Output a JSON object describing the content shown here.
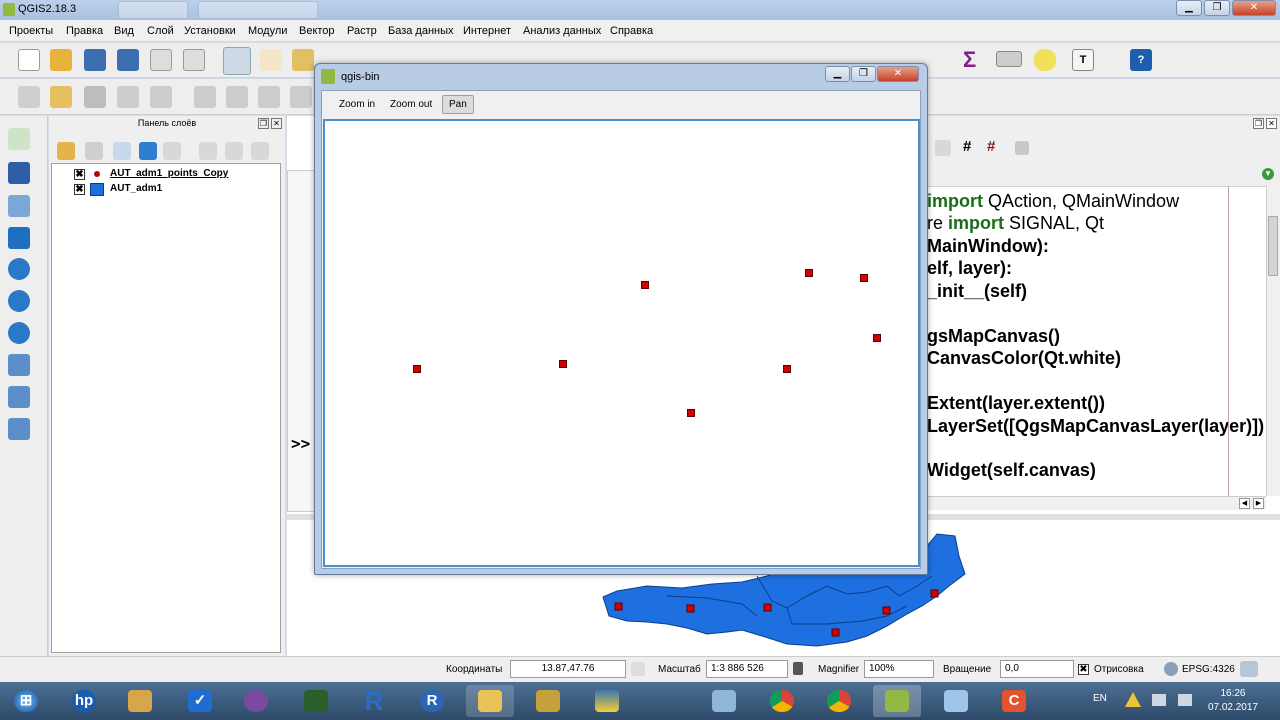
{
  "app": {
    "title": "QGIS2.18.3"
  },
  "menubar": [
    "Проекты",
    "Правка",
    "Вид",
    "Слой",
    "Установки",
    "Модули",
    "Вектор",
    "Растр",
    "База данных",
    "Интернет",
    "Анализ данных",
    "Справка"
  ],
  "layers_panel": {
    "title": "Панель слоёв",
    "layers": [
      {
        "name": "AUT_adm1_points_Copy",
        "checked": "✖",
        "symbol": "point",
        "color": "#c00000"
      },
      {
        "name": "AUT_adm1",
        "checked": "✖",
        "symbol": "polygon",
        "color": "#1e6fe0"
      }
    ]
  },
  "python_console": {
    "prompt": ">>",
    "code_lines": [
      {
        "pre": "",
        "kw": "import",
        "post": " QAction, QMainWindow"
      },
      {
        "pre": "re ",
        "kw": "import",
        "post": " SIGNAL, Qt"
      },
      {
        "pre": "",
        "kw": "",
        "post": "MainWindow):"
      },
      {
        "pre": "",
        "kw": "",
        "post": "elf, layer):"
      },
      {
        "pre": "",
        "kw": "",
        "post": "_init__(self)"
      },
      {
        "pre": "",
        "kw": "",
        "post": ""
      },
      {
        "pre": "",
        "kw": "",
        "post": "gsMapCanvas()"
      },
      {
        "pre": "",
        "kw": "",
        "post": "CanvasColor(Qt.white)"
      },
      {
        "pre": "",
        "kw": "",
        "post": ""
      },
      {
        "pre": "",
        "kw": "",
        "post": "Extent(layer.extent())"
      },
      {
        "pre": "",
        "kw": "",
        "post": "LayerSet([QgsMapCanvasLayer(layer)])"
      },
      {
        "pre": "",
        "kw": "",
        "post": ""
      },
      {
        "pre": "",
        "kw": "",
        "post": "Widget(self.canvas)"
      }
    ]
  },
  "dialog": {
    "title": "qgis-bin",
    "buttons": {
      "zoom_in": "Zoom in",
      "zoom_out": "Zoom out",
      "pan": "Pan"
    },
    "active_tool": "Pan"
  },
  "map": {
    "polygon_color": "#1e6fe0",
    "point_color": "#d40000"
  },
  "statusbar": {
    "coords_label": "Координаты",
    "coords_value": "13.87,47.76",
    "scale_label": "Масштаб",
    "scale_value": "1:3 886 526",
    "magnifier_label": "Magnifier",
    "magnifier_value": "100%",
    "rotation_label": "Вращение",
    "rotation_value": "0,0",
    "render_label": "Отрисовка",
    "render_checked": "✖",
    "crs": "EPSG:4326"
  },
  "taskbar": {
    "lang": "EN",
    "time": "16:26",
    "date": "07.02.2017",
    "apps": [
      "start",
      "hp",
      "paint",
      "mail",
      "chart",
      "tools",
      "r",
      "r-gui",
      "explorer",
      "package",
      "python",
      "chrome",
      "chrome2",
      "qgis",
      "ghost",
      "c-app"
    ]
  }
}
